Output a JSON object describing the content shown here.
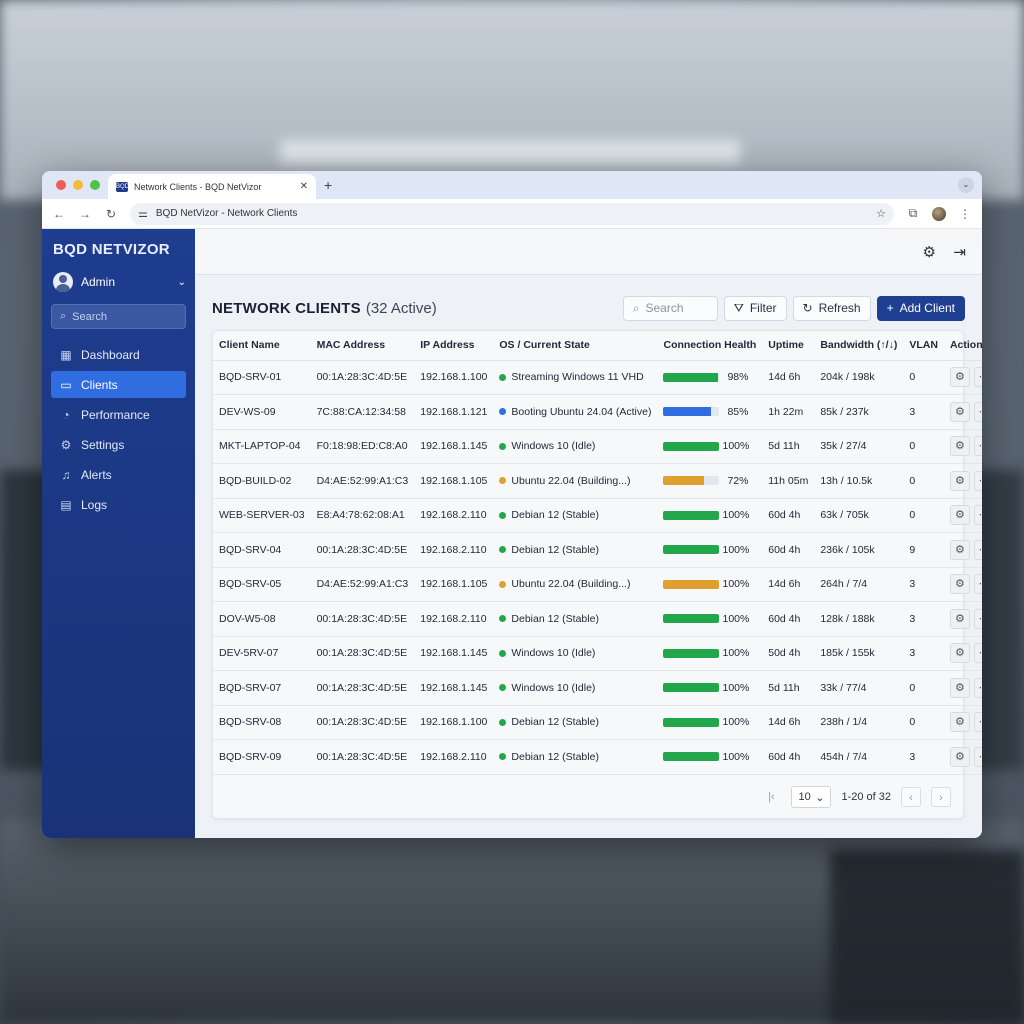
{
  "browser": {
    "tab_title": "Network Clients - BQD NetVizor",
    "address": "BQD NetVizor - Network Clients",
    "favicon_text": "BQD"
  },
  "sidebar": {
    "brand": "BQD NETVIZOR",
    "user": "Admin",
    "search_placeholder": "Search",
    "items": [
      {
        "label": "Dashboard",
        "icon": "grid-icon",
        "glyph": "▦",
        "active": false
      },
      {
        "label": "Clients",
        "icon": "monitor-icon",
        "glyph": "▭",
        "active": true
      },
      {
        "label": "Performance",
        "icon": "gauge-icon",
        "glyph": "◔",
        "active": false
      },
      {
        "label": "Settings",
        "icon": "gear-icon",
        "glyph": "⚙",
        "active": false
      },
      {
        "label": "Alerts",
        "icon": "bell-icon",
        "glyph": "♫",
        "active": false
      },
      {
        "label": "Logs",
        "icon": "file-icon",
        "glyph": "▤",
        "active": false
      }
    ]
  },
  "header": {
    "title": "NETWORK CLIENTS",
    "count": "(32 Active)",
    "search_placeholder": "Search",
    "filter_label": "Filter",
    "refresh_label": "Refresh",
    "add_label": "Add Client"
  },
  "table": {
    "columns": [
      "Client Name",
      "MAC Address",
      "IP Address",
      "OS / Current State",
      "Connection Health",
      "Uptime",
      "Bandwidth (↑/↓)",
      "VLAN",
      "Actions"
    ],
    "rows": [
      {
        "name": "BQD-SRV-01",
        "mac": "00:1A:28:3C:4D:5E",
        "ip": "192.168.1.100",
        "state": "Streaming Windows 11 VHD",
        "status": "green",
        "health": 98,
        "health_label": "98%",
        "uptime": "14d 6h",
        "bandwidth": "204k / 198k",
        "vlan": "0"
      },
      {
        "name": "DEV-WS-09",
        "mac": "7C:88:CA:12:34:58",
        "ip": "192.168.1.121",
        "state": "Booting Ubuntu 24.04 (Active)",
        "status": "blue",
        "health": 85,
        "health_label": "85%",
        "uptime": "1h 22m",
        "bandwidth": "85k / 237k",
        "vlan": "3"
      },
      {
        "name": "MKT-LAPTOP-04",
        "mac": "F0:18:98:ED:C8:A0",
        "ip": "192.168.1.145",
        "state": "Windows 10 (Idle)",
        "status": "green",
        "health": 100,
        "health_label": "100%",
        "uptime": "5d 11h",
        "bandwidth": "35k / 27/4",
        "vlan": "0"
      },
      {
        "name": "BQD-BUILD-02",
        "mac": "D4:AE:52:99:A1:C3",
        "ip": "192.168.1.105",
        "state": "Ubuntu 22.04 (Building...)",
        "status": "orange",
        "health": 72,
        "health_label": "72%",
        "uptime": "11h 05m",
        "bandwidth": "13h / 10.5k",
        "vlan": "0"
      },
      {
        "name": "WEB-SERVER-03",
        "mac": "E8:A4:78:62:08:A1",
        "ip": "192.168.2.110",
        "state": "Debian 12 (Stable)",
        "status": "green",
        "health": 100,
        "health_label": "100%",
        "uptime": "60d 4h",
        "bandwidth": "63k / 705k",
        "vlan": "0"
      },
      {
        "name": "BQD-SRV-04",
        "mac": "00:1A:28:3C:4D:5E",
        "ip": "192.168.2.110",
        "state": "Debian 12 (Stable)",
        "status": "green",
        "health": 100,
        "health_label": "100%",
        "uptime": "60d 4h",
        "bandwidth": "236k / 105k",
        "vlan": "9"
      },
      {
        "name": "BQD-SRV-05",
        "mac": "D4:AE:52:99:A1:C3",
        "ip": "192.168.1.105",
        "state": "Ubuntu 22.04 (Building...)",
        "status": "orange",
        "health": 100,
        "health_label": "100%",
        "uptime": "14d 6h",
        "bandwidth": "264h / 7/4",
        "vlan": "3"
      },
      {
        "name": "DOV-W5-08",
        "mac": "00:1A:28:3C:4D:5E",
        "ip": "192.168.2.110",
        "state": "Debian 12 (Stable)",
        "status": "green",
        "health": 100,
        "health_label": "100%",
        "uptime": "60d 4h",
        "bandwidth": "128k / 188k",
        "vlan": "3"
      },
      {
        "name": "DEV-5RV-07",
        "mac": "00:1A:28:3C:4D:5E",
        "ip": "192.168.1.145",
        "state": "Windows 10 (Idle)",
        "status": "green",
        "health": 100,
        "health_label": "100%",
        "uptime": "50d 4h",
        "bandwidth": "185k / 155k",
        "vlan": "3"
      },
      {
        "name": "BQD-SRV-07",
        "mac": "00:1A:28:3C:4D:5E",
        "ip": "192.168.1.145",
        "state": "Windows 10 (Idle)",
        "status": "green",
        "health": 100,
        "health_label": "100%",
        "uptime": "5d 11h",
        "bandwidth": "33k / 77/4",
        "vlan": "0"
      },
      {
        "name": "BQD-SRV-08",
        "mac": "00:1A:28:3C:4D:5E",
        "ip": "192.168.1.100",
        "state": "Debian 12 (Stable)",
        "status": "green",
        "health": 100,
        "health_label": "100%",
        "uptime": "14d 6h",
        "bandwidth": "238h / 1/4",
        "vlan": "0"
      },
      {
        "name": "BQD-SRV-09",
        "mac": "00:1A:28:3C:4D:5E",
        "ip": "192.168.2.110",
        "state": "Debian 12 (Stable)",
        "status": "green",
        "health": 100,
        "health_label": "100%",
        "uptime": "60d 4h",
        "bandwidth": "454h / 7/4",
        "vlan": "3"
      }
    ]
  },
  "pagination": {
    "page_size": "10",
    "range": "1-20 of 32"
  },
  "colors": {
    "green": "#22a84a",
    "blue": "#2f6de0",
    "orange": "#e0a030",
    "brand": "#1f3f93"
  }
}
